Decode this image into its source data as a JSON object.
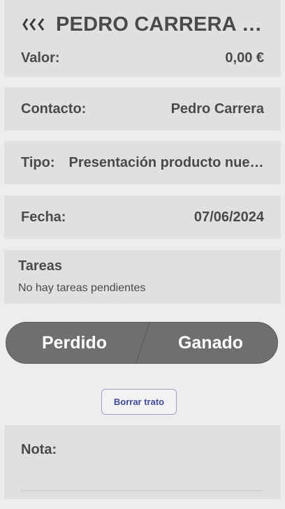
{
  "header": {
    "title": "PEDRO CARRERA - PRESENTACIÓN PRODUCTO",
    "back_icon": "double-chevron-left-icon"
  },
  "valor": {
    "label": "Valor:",
    "value": "0,00 €"
  },
  "contacto": {
    "label": "Contacto:",
    "value": "Pedro Carrera"
  },
  "tipo": {
    "label": "Tipo:",
    "value": "Presentación producto nuevo"
  },
  "fecha": {
    "label": "Fecha:",
    "value": "07/06/2024"
  },
  "tareas": {
    "title": "Tareas",
    "empty_text": "No hay tareas pendientes"
  },
  "result_switch": {
    "lost_label": "Perdido",
    "won_label": "Ganado"
  },
  "delete_button": {
    "label": "Borrar trato"
  },
  "nota": {
    "label": "Nota:",
    "value": ""
  },
  "colors": {
    "card_bg": "#e0e0e0",
    "page_bg": "#ededed",
    "switch_bg": "#6f6f6f",
    "delete_text": "#3f4b9a"
  }
}
